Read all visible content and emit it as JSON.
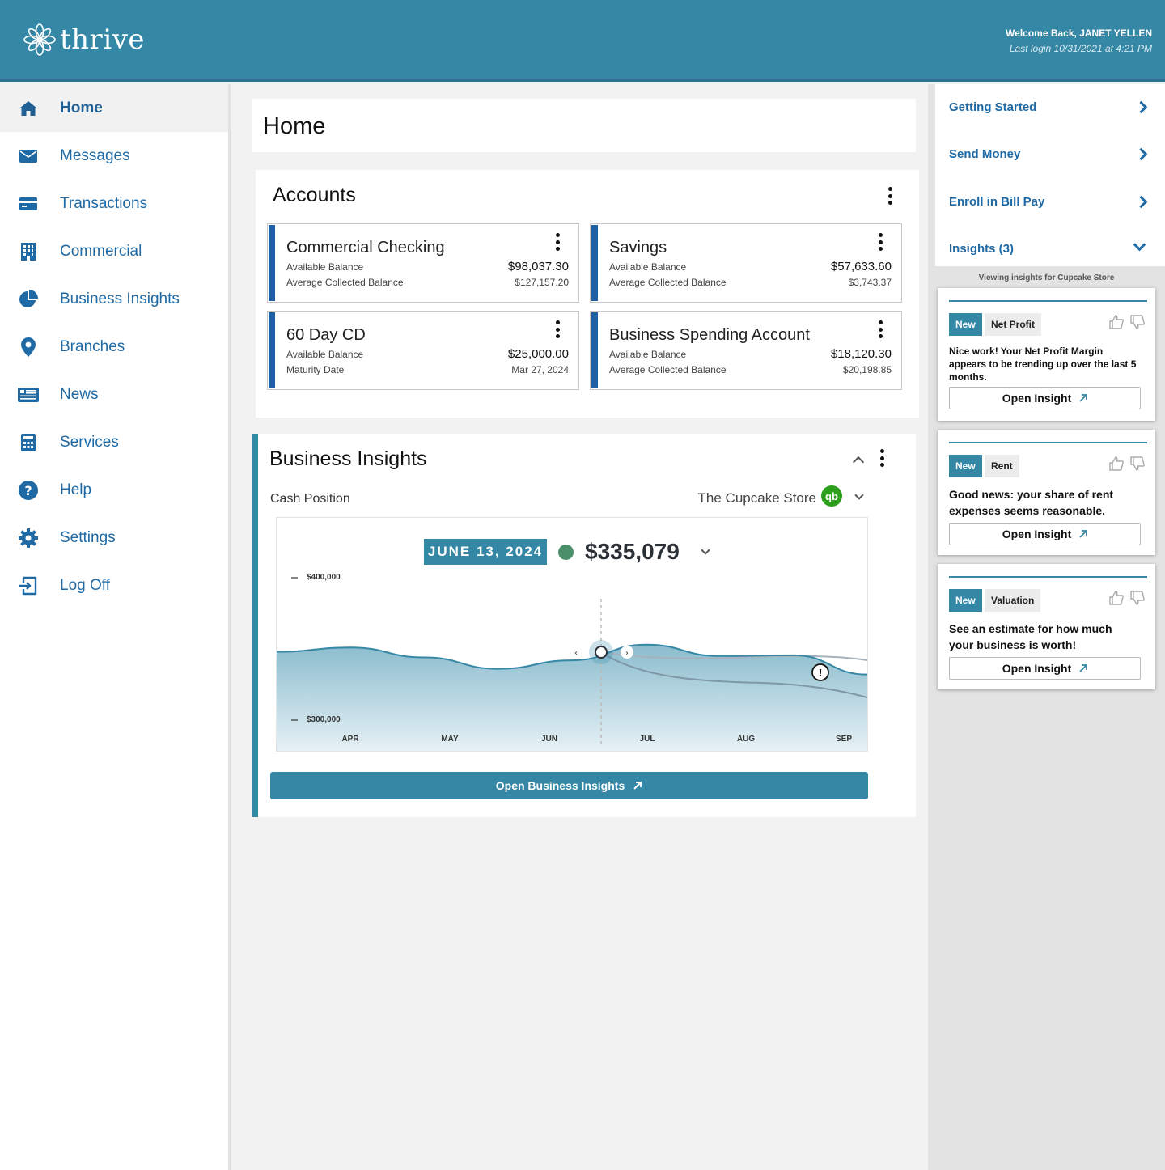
{
  "brand": {
    "name": "thrive"
  },
  "user": {
    "welcome": "Welcome Back, JANET YELLEN",
    "last_login": "Last login 10/31/2021 at 4:21 PM"
  },
  "nav": {
    "items": [
      {
        "label": "Home",
        "icon": "home-icon"
      },
      {
        "label": "Messages",
        "icon": "envelope-icon"
      },
      {
        "label": "Transactions",
        "icon": "credit-card-icon"
      },
      {
        "label": "Commercial",
        "icon": "building-icon"
      },
      {
        "label": "Business Insights",
        "icon": "pie-chart-icon"
      },
      {
        "label": "Branches",
        "icon": "map-pin-icon"
      },
      {
        "label": "News",
        "icon": "newspaper-icon"
      },
      {
        "label": "Services",
        "icon": "calculator-icon"
      },
      {
        "label": "Help",
        "icon": "question-circle-icon"
      },
      {
        "label": "Settings",
        "icon": "gear-icon"
      },
      {
        "label": "Log Off",
        "icon": "sign-out-icon"
      }
    ],
    "active": "Home"
  },
  "page": {
    "title": "Home"
  },
  "accounts": {
    "title": "Accounts",
    "items": [
      {
        "name": "Commercial Checking",
        "label1": "Available Balance",
        "value1": "$98,037.30",
        "label2": "Average Collected Balance",
        "value2": "$127,157.20"
      },
      {
        "name": "Savings",
        "label1": "Available Balance",
        "value1": "$57,633.60",
        "label2": "Average Collected Balance",
        "value2": "$3,743.37"
      },
      {
        "name": "60 Day CD",
        "label1": "Available Balance",
        "value1": "$25,000.00",
        "label2": "Maturity Date",
        "value2": "Mar 27, 2024"
      },
      {
        "name": "Business Spending Account",
        "label1": "Available Balance",
        "value1": "$18,120.30",
        "label2": "Average Collected Balance",
        "value2": "$20,198.85"
      }
    ]
  },
  "insights_card": {
    "title": "Business Insights",
    "subtitle": "Cash Position",
    "store": "The Cupcake Store",
    "qb_label": "qb",
    "selected_date": "JUNE 13, 2024",
    "selected_amount": "$335,079",
    "open_button": "Open Business Insights"
  },
  "chart_data": {
    "type": "area",
    "title": "Cash Position",
    "x": [
      "APR",
      "MAY",
      "JUN",
      "JUL",
      "AUG",
      "SEP"
    ],
    "y_ticks": [
      "$400,000",
      "$300,000"
    ],
    "ylim": [
      300000,
      400000
    ],
    "series": [
      {
        "values": [
          348000,
          351000,
          344000,
          336000,
          342000,
          353000,
          345000,
          345500,
          332000
        ]
      }
    ],
    "selected": {
      "x": "JUN",
      "label": "JUNE 13, 2024",
      "value": 335079
    },
    "grid": false
  },
  "quick_links": [
    {
      "label": "Getting Started"
    },
    {
      "label": "Send Money"
    },
    {
      "label": "Enroll in Bill Pay"
    },
    {
      "label": "Insights (3)"
    }
  ],
  "insights_panel": {
    "viewing": "Viewing insights for Cupcake Store",
    "items": [
      {
        "badge": "New",
        "category": "Net Profit",
        "text": "Nice work! Your Net Profit Margin appears to be trending up over the last 5 months.",
        "button": "Open Insight"
      },
      {
        "badge": "New",
        "category": "Rent",
        "text": "Good news: your share of rent expenses seems reasonable.",
        "button": "Open Insight"
      },
      {
        "badge": "New",
        "category": "Valuation",
        "text": "See an estimate for how much your business is worth!",
        "button": "Open Insight"
      }
    ]
  },
  "colors": {
    "brand": "#3587a6",
    "link": "#1f6aa5",
    "account_bar": "#1f5fa3",
    "qb_green": "#2ca01c"
  }
}
